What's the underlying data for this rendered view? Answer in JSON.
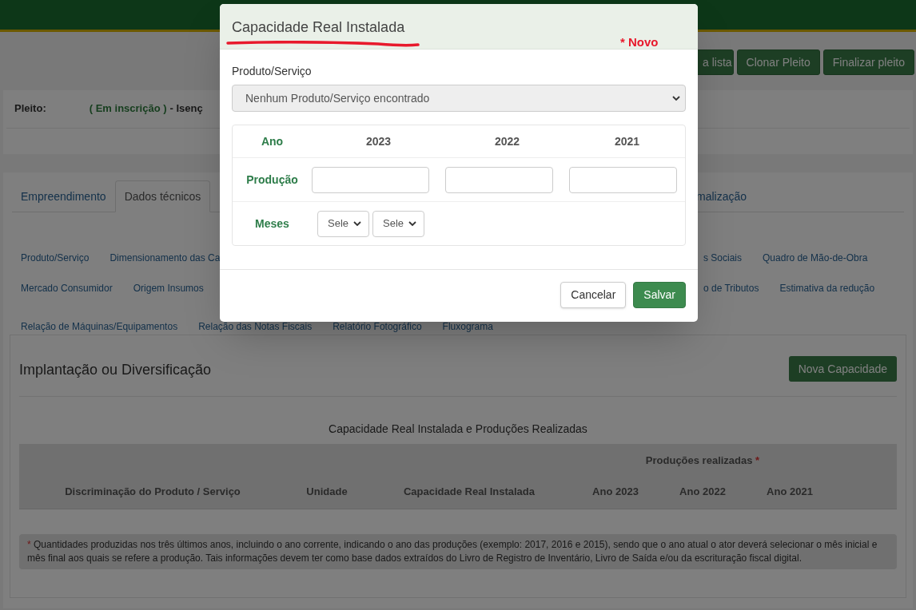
{
  "header": {
    "buttons": [
      {
        "label": "a lista"
      },
      {
        "label": "Clonar Pleito"
      },
      {
        "label": "Finalizar pleito"
      }
    ]
  },
  "pleito": {
    "label": "Pleito:",
    "status": "( Em inscrição )",
    "suffix": "- Isenç"
  },
  "tabs": [
    {
      "label": "Empreendimento",
      "selected": false
    },
    {
      "label": "Dados técnicos",
      "selected": true
    },
    {
      "label": "malização",
      "selected": false
    }
  ],
  "subnav": [
    {
      "left": [
        "Produto/Serviço",
        "Dimensionamento das Ca"
      ],
      "right": [
        "s Sociais",
        "Quadro de Mão-de-Obra"
      ]
    },
    {
      "left": [
        "Mercado Consumidor",
        "Origem Insumos"
      ],
      "right": [
        "o de Tributos",
        "Estimativa da redução"
      ]
    },
    {
      "left": [
        "Relação de Máquinas/Equipamentos",
        "Relação das Notas Fiscais",
        "Relatório Fotográfico",
        "Fluxograma"
      ]
    }
  ],
  "section": {
    "title": "Implantação ou Diversificação",
    "button": "Nova Capacidade",
    "caption": "Capacidade Real Instalada e Produções Realizadas",
    "group_header": {
      "label": "Produções realizadas",
      "asterisk": "*"
    },
    "columns": [
      "Discriminação do Produto / Serviço",
      "Unidade",
      "Capacidade Real Instalada",
      "Ano 2023",
      "Ano 2022",
      "Ano 2021"
    ],
    "footnote": {
      "asterisk": "*",
      "text": "Quantidades produzidas nos três últimos anos, incluindo o ano corrente, indicando o ano das produções (exemplo: 2017, 2016 e 2015), sendo que o ano atual o ator deverá selecionar o mês inicial e mês final aos quais se refere a produção. Tais informações devem ter como base dados extraídos do Livro de Registro de Inventário, Livro de Saída e/ou da escrituração fiscal digital."
    }
  },
  "modal": {
    "title": "Capacidade Real Instalada",
    "note": "* Novo",
    "field_label": "Produto/Serviço",
    "select_value": "Nenhum Produto/Serviço encontrado",
    "disabled": true,
    "year_label": "Ano",
    "years": [
      "2023",
      "2022",
      "2021"
    ],
    "production_label": "Produção",
    "months_label": "Meses",
    "month_selects": [
      "Sele",
      "Sele"
    ],
    "buttons": [
      {
        "label": "Cancelar",
        "kind": "secondary"
      },
      {
        "label": "Salvar",
        "kind": "primary"
      }
    ]
  }
}
